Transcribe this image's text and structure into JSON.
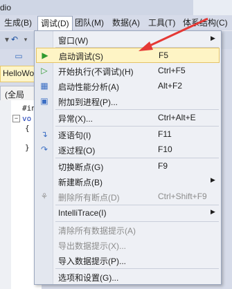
{
  "title": "dio",
  "menubar": {
    "items": [
      "生成(B)",
      "调试(D)",
      "团队(M)",
      "数据(A)",
      "工具(T)",
      "体系结构(C)"
    ]
  },
  "document": {
    "tab": "HelloWo",
    "scope": "(全局",
    "code": [
      "#in",
      "vo",
      "{",
      "}"
    ]
  },
  "menu": {
    "items": [
      {
        "label": "窗口(W)",
        "shortcut": "",
        "submenu": true,
        "icon": "",
        "disabled": false
      },
      {
        "label": "启动调试(S)",
        "shortcut": "F5",
        "submenu": false,
        "icon": "play-icon",
        "disabled": false,
        "highlighted": true
      },
      {
        "label": "开始执行(不调试)(H)",
        "shortcut": "Ctrl+F5",
        "submenu": false,
        "icon": "run-outline-icon",
        "disabled": false
      },
      {
        "label": "启动性能分析(A)",
        "shortcut": "Alt+F2",
        "submenu": false,
        "icon": "performance-icon",
        "disabled": false
      },
      {
        "label": "附加到进程(P)...",
        "shortcut": "",
        "submenu": false,
        "icon": "attach-process-icon",
        "disabled": false
      },
      {
        "label": "异常(X)...",
        "shortcut": "Ctrl+Alt+E",
        "submenu": false,
        "icon": "",
        "disabled": false
      },
      {
        "label": "逐语句(I)",
        "shortcut": "F11",
        "submenu": false,
        "icon": "step-into-icon",
        "disabled": false
      },
      {
        "label": "逐过程(O)",
        "shortcut": "F10",
        "submenu": false,
        "icon": "step-over-icon",
        "disabled": false
      },
      {
        "label": "切换断点(G)",
        "shortcut": "F9",
        "submenu": false,
        "icon": "",
        "disabled": false
      },
      {
        "label": "新建断点(B)",
        "shortcut": "",
        "submenu": true,
        "icon": "",
        "disabled": false
      },
      {
        "label": "删除所有断点(D)",
        "shortcut": "Ctrl+Shift+F9",
        "submenu": false,
        "icon": "delete-breakpoints-icon",
        "disabled": true
      },
      {
        "label": "IntelliTrace(I)",
        "shortcut": "",
        "submenu": true,
        "icon": "",
        "disabled": false
      },
      {
        "label": "清除所有数据提示(A)",
        "shortcut": "",
        "submenu": false,
        "icon": "",
        "disabled": true
      },
      {
        "label": "导出数据提示(X)...",
        "shortcut": "",
        "submenu": false,
        "icon": "",
        "disabled": true
      },
      {
        "label": "导入数据提示(P)...",
        "shortcut": "",
        "submenu": false,
        "icon": "",
        "disabled": false
      },
      {
        "label": "选项和设置(G)...",
        "shortcut": "",
        "submenu": false,
        "icon": "",
        "disabled": false
      }
    ]
  },
  "colors": {
    "highlight_bg": "#fef4c5",
    "highlight_border": "#e5c365",
    "annotation_arrow": "#e53935",
    "play_green": "#2f9a2f"
  }
}
